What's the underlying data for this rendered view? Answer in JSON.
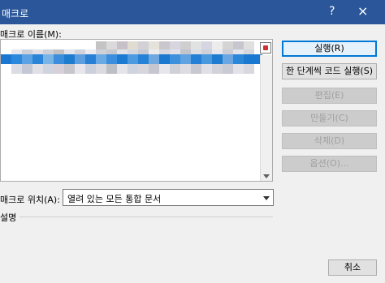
{
  "window": {
    "title": "매크로",
    "help_glyph": "?",
    "close_glyph": "×"
  },
  "macro_list": {
    "label": "매크로 이름(M):",
    "selected_row": 1,
    "rows_blurred": true
  },
  "buttons": {
    "run": "실행(R)",
    "step_into": "한 단계씩 코드 실행(S)",
    "edit": "편집(E)",
    "create": "만들기(C)",
    "delete": "삭제(D)",
    "options": "옵션(O)...",
    "cancel": "취소"
  },
  "location": {
    "label": "매크로 위치(A):",
    "value": "열려 있는 모든 통합 문서"
  },
  "description": {
    "label": "설명"
  },
  "colors": {
    "titlebar": "#2b579a",
    "selection": "#1a78d0",
    "primary_border": "#0078d7"
  },
  "icons": [
    "close-icon",
    "help-icon",
    "macro-edit-icon",
    "dropdown-chevron-icon",
    "scroll-down-icon"
  ]
}
